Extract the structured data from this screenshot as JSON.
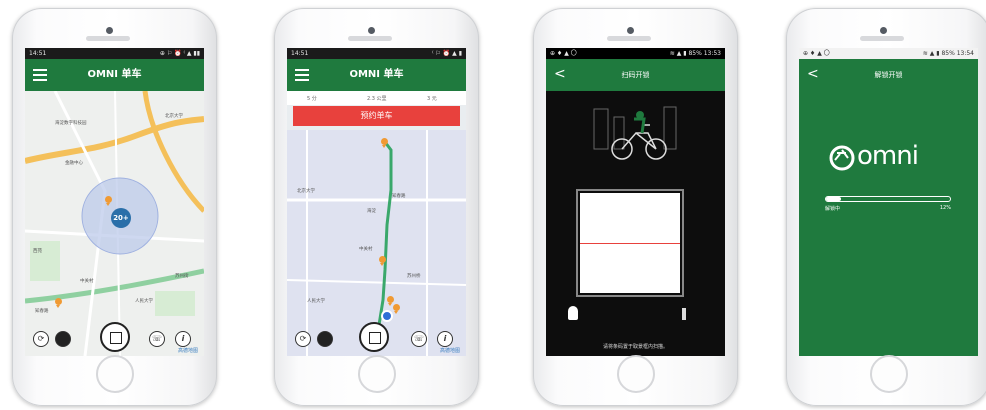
{
  "phone1": {
    "status": {
      "time": "14:51",
      "right": "⊕ ⚐ ⏰ ⁽ ▲ ▮▮"
    },
    "title": "OMNI 单车",
    "cluster_count": "20+",
    "map_labels": [
      "海淀数字科技园",
      "金融中心",
      "中关村",
      "西苑",
      "苏州街",
      "北京大学",
      "知春路",
      "人民大学"
    ],
    "legal": "高德地图"
  },
  "phone2": {
    "status": {
      "time": "14:51",
      "right": "⁽ ⚐ ⏰ ▲ ▮"
    },
    "title": "OMNI 单车",
    "steps": [
      "5 分",
      "2.3 公里",
      "3 元"
    ],
    "reserve_label": "预约单车",
    "map_labels": [
      "北京大学",
      "知春路",
      "海淀",
      "中关村",
      "苏州桥",
      "人民大学"
    ],
    "legal": "高德地图"
  },
  "phone3": {
    "status": {
      "left": "⊕ ♦ ▲ 〇",
      "right": "≋ ▲ ▮ 85%  13:53"
    },
    "title": "扫码开锁",
    "hint": "请将条码置于取景框内扫描。"
  },
  "phone4": {
    "status": {
      "left": "⊕ ♦ ▲ 〇",
      "right": "≋ ▲ ▮ 85%  13:54"
    },
    "title": "解锁开锁",
    "logo": "omni",
    "progress_label": "解锁中",
    "progress_percent_label": "12%",
    "progress_value": 0.12
  },
  "colors": {
    "green": "#1f7a3e",
    "red": "#e8413d",
    "orange": "#f09a33",
    "route": "#3aa86b"
  }
}
